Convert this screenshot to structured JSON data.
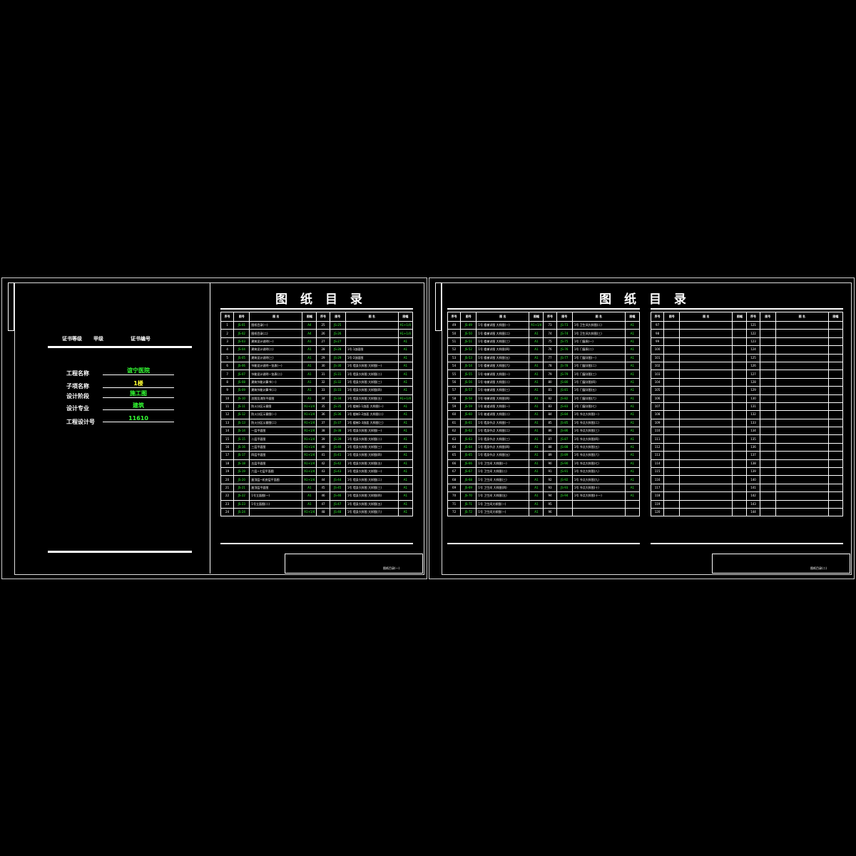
{
  "left_sheet": {
    "title": "图 纸 目 录",
    "cert_grade_label": "证书等级",
    "cert_grade_value": "甲级",
    "cert_number_label": "证书编号",
    "project": [
      {
        "label": "工程名称",
        "value": "谊宁医院"
      },
      {
        "label": "子项名称",
        "value": "1楼"
      },
      {
        "label": "设计阶段",
        "value": "施工图"
      },
      {
        "label": "设计专业",
        "value": "建筑"
      },
      {
        "label": "工程设计号",
        "value": "11610"
      }
    ],
    "headers": [
      "序号",
      "图号",
      "图  名",
      "图幅",
      "序号",
      "图号",
      "图  名",
      "图幅"
    ],
    "rows": [
      [
        "1",
        "JS-01",
        "图纸目录(一)",
        "A4",
        "25",
        "JS-25",
        "",
        "A1+1/4"
      ],
      [
        "2",
        "JS-02",
        "图纸目录(二)",
        "A4",
        "26",
        "JS-26",
        "",
        "A1+1/4"
      ],
      [
        "3",
        "JS-03",
        "建筑设计说明(一)",
        "A1",
        "27",
        "JS-27",
        "",
        "A1"
      ],
      [
        "4",
        "JS-04",
        "建筑设计说明(二)",
        "A1",
        "28",
        "JS-28",
        "1号-1剖面图",
        "A1"
      ],
      [
        "5",
        "JS-05",
        "建筑设计说明(三)",
        "A1",
        "29",
        "JS-29",
        "1号-2剖面图",
        "A1"
      ],
      [
        "6",
        "JS-06",
        "节能设计说明一览表(一)",
        "A1",
        "30",
        "JS-30",
        "1号 墙身大样图 大样图(一)",
        "A1"
      ],
      [
        "7",
        "JS-07",
        "节能设计说明一览表(二)",
        "A1",
        "31",
        "JS-31",
        "1号 墙身大样图 大样图(二)",
        "A1"
      ],
      [
        "8",
        "JS-08",
        "建筑节能计算书(一)",
        "A1",
        "32",
        "JS-32",
        "1号 墙身大样图 大样图(三)",
        "A1"
      ],
      [
        "9",
        "JS-09",
        "建筑节能计算书(二)",
        "A1",
        "33",
        "JS-33",
        "1号 墙身大样图 大样图(四)",
        "A1"
      ],
      [
        "10",
        "JS-10",
        "总图及消防平面图",
        "A1",
        "34",
        "JS-34",
        "1号 墙身大样图 大样图(五)",
        "A1+1/4"
      ],
      [
        "11",
        "JS-11",
        "防火分区示意图",
        "A1+1/4",
        "35",
        "JS-35",
        "1号 楼梯1-1剖面 大样图(一)",
        "A1"
      ],
      [
        "12",
        "JS-12",
        "防火分区示意图(一)",
        "A1+1/4",
        "36",
        "JS-36",
        "1号 楼梯1-2剖面 大样图(二)",
        "A1"
      ],
      [
        "13",
        "JS-13",
        "防火分区示意图(二)",
        "A1+1/4",
        "37",
        "JS-37",
        "1号 楼梯1-3剖面 大样图(三)",
        "A1"
      ],
      [
        "14",
        "JS-14",
        "一层平面图",
        "A1+1/4",
        "38",
        "JS-38",
        "1号 墙身大样图 大样图(一)",
        "A1"
      ],
      [
        "15",
        "JS-15",
        "二层平面图",
        "A1+1/4",
        "39",
        "JS-39",
        "1号 墙身大样图 大样图(二)",
        "A1"
      ],
      [
        "16",
        "JS-16",
        "三层平面图",
        "A1+1/4",
        "40",
        "JS-40",
        "1号 墙身大样图 大样图(三)",
        "A1"
      ],
      [
        "17",
        "JS-17",
        "四层平面图",
        "A1+1/4",
        "41",
        "JS-41",
        "1号 墙身大样图 大样图(四)",
        "A1"
      ],
      [
        "18",
        "JS-18",
        "五层平面图",
        "A1+1/4",
        "42",
        "JS-42",
        "1号 墙身大样图 大样图(五)",
        "A1"
      ],
      [
        "19",
        "JS-19",
        "六层~七层平面图",
        "A1+1/4",
        "43",
        "JS-43",
        "1号 墙身大样图 大样图(一)",
        "A1"
      ],
      [
        "20",
        "JS-20",
        "屋顶层~机房层平面图",
        "A1+1/4",
        "44",
        "JS-44",
        "1号 墙身大样图 大样图(二)",
        "A1"
      ],
      [
        "21",
        "JS-21",
        "屋顶层平面图",
        "A1",
        "45",
        "JS-45",
        "1号 墙身大样图 大样图(三)",
        "A1"
      ],
      [
        "22",
        "JS-22",
        "1号立面图(一)",
        "A1",
        "46",
        "JS-46",
        "1号 墙身大样图 大样图(四)",
        "A1"
      ],
      [
        "23",
        "JS-23",
        "1号立面图(二)",
        "A1",
        "47",
        "JS-47",
        "1号 墙身大样图 大样图(五)",
        "A1"
      ],
      [
        "24",
        "JS-24",
        "",
        "A1+1/4",
        "48",
        "JS-48",
        "1号 墙身大样图 大样图(六)",
        "A1"
      ]
    ],
    "title_block": {
      "name": "图纸目录(一)"
    }
  },
  "right_sheet": {
    "title": "图 纸 目 录",
    "headers": [
      "序号",
      "图号",
      "图  名",
      "图幅",
      "序号",
      "图号",
      "图  名",
      "图幅"
    ],
    "rows": [
      [
        "49",
        "JS-49",
        "1号 楼梯详图 大样图(一)",
        "A1+1/4",
        "73",
        "JS-73",
        "1号 卫生间大样图(二)",
        "A1"
      ],
      [
        "50",
        "JS-50",
        "1号 楼梯详图 大样图(二)",
        "A1",
        "74",
        "JS-74",
        "1号 卫生间大样图(三)",
        "A1"
      ],
      [
        "51",
        "JS-51",
        "1号 楼梯详图 大样图(三)",
        "A1",
        "75",
        "JS-75",
        "1号 门窗表(一)",
        "A1"
      ],
      [
        "52",
        "JS-52",
        "1号 楼梯详图 大样图(四)",
        "A1",
        "76",
        "JS-76",
        "1号 门窗表(二)",
        "A1"
      ],
      [
        "53",
        "JS-53",
        "1号 楼梯详图 大样图(五)",
        "A1",
        "77",
        "JS-77",
        "1号 门窗详图(一)",
        "A1"
      ],
      [
        "54",
        "JS-54",
        "1号 楼梯详图 大样图(六)",
        "A1",
        "78",
        "JS-78",
        "1号 门窗详图(二)",
        "A1"
      ],
      [
        "55",
        "JS-55",
        "1号 电梯详图 大样图(一)",
        "A1",
        "79",
        "JS-79",
        "1号 门窗详图(三)",
        "A1"
      ],
      [
        "56",
        "JS-56",
        "1号 电梯详图 大样图(二)",
        "A1",
        "80",
        "JS-80",
        "1号 门窗详图(四)",
        "A1"
      ],
      [
        "57",
        "JS-57",
        "1号 电梯详图 大样图(三)",
        "A1",
        "81",
        "JS-81",
        "1号 门窗详图(五)",
        "A1"
      ],
      [
        "58",
        "JS-58",
        "1号 电梯详图 大样图(四)",
        "A1",
        "82",
        "JS-82",
        "1号 门窗详图(六)",
        "A1"
      ],
      [
        "59",
        "JS-59",
        "1号 坡道详图 大样图(一)",
        "A1",
        "83",
        "JS-83",
        "1号 门窗详图(七)",
        "A1"
      ],
      [
        "60",
        "JS-60",
        "1号 坡道详图 大样图(二)",
        "A1",
        "84",
        "JS-84",
        "1号 节点大样图(一)",
        "A1"
      ],
      [
        "61",
        "JS-61",
        "1号 墙身节点 大样图(一)",
        "A1",
        "85",
        "JS-85",
        "1号 节点大样图(二)",
        "A1"
      ],
      [
        "62",
        "JS-62",
        "1号 墙身节点 大样图(二)",
        "A1",
        "86",
        "JS-86",
        "1号 节点大样图(三)",
        "A1"
      ],
      [
        "63",
        "JS-63",
        "1号 墙身节点 大样图(三)",
        "A1",
        "87",
        "JS-87",
        "1号 节点大样图(四)",
        "A1"
      ],
      [
        "64",
        "JS-64",
        "1号 墙身节点 大样图(四)",
        "A1",
        "88",
        "JS-88",
        "1号 节点大样图(五)",
        "A1"
      ],
      [
        "65",
        "JS-65",
        "1号 墙身节点 大样图(五)",
        "A1",
        "89",
        "JS-89",
        "1号 节点大样图(六)",
        "A1"
      ],
      [
        "66",
        "JS-66",
        "1号 卫生间 大样图(一)",
        "A1",
        "90",
        "JS-90",
        "1号 节点大样图(七)",
        "A1"
      ],
      [
        "67",
        "JS-67",
        "1号 卫生间 大样图(二)",
        "A1",
        "91",
        "JS-91",
        "1号 节点大样图(八)",
        "A1"
      ],
      [
        "68",
        "JS-68",
        "1号 卫生间 大样图(三)",
        "A1",
        "92",
        "JS-92",
        "1号 节点大样图(九)",
        "A1"
      ],
      [
        "69",
        "JS-69",
        "1号 卫生间 大样图(四)",
        "A1",
        "93",
        "JS-93",
        "1号 节点大样图(十)",
        "A1"
      ],
      [
        "70",
        "JS-70",
        "1号 卫生间 大样图(五)",
        "A1",
        "94",
        "JS-94",
        "1号 节点大样图(十一)",
        "A1"
      ],
      [
        "71",
        "JS-71",
        "1号 卫生间大样图(一)",
        "A1",
        "95",
        "",
        "",
        ""
      ],
      [
        "72",
        "JS-72",
        "1号 卫生间大样图(一)",
        "A1",
        "96",
        "",
        "",
        ""
      ]
    ],
    "extra_headers": [
      "序号",
      "图号",
      "图  名",
      "图幅",
      "序号",
      "图号",
      "图  名",
      "图幅"
    ],
    "extra_rows": [
      [
        "97",
        "",
        "",
        "",
        "121",
        "",
        "",
        ""
      ],
      [
        "98",
        "",
        "",
        "",
        "122",
        "",
        "",
        ""
      ],
      [
        "99",
        "",
        "",
        "",
        "123",
        "",
        "",
        ""
      ],
      [
        "100",
        "",
        "",
        "",
        "124",
        "",
        "",
        ""
      ],
      [
        "101",
        "",
        "",
        "",
        "125",
        "",
        "",
        ""
      ],
      [
        "102",
        "",
        "",
        "",
        "126",
        "",
        "",
        ""
      ],
      [
        "103",
        "",
        "",
        "",
        "127",
        "",
        "",
        ""
      ],
      [
        "104",
        "",
        "",
        "",
        "128",
        "",
        "",
        ""
      ],
      [
        "105",
        "",
        "",
        "",
        "129",
        "",
        "",
        ""
      ],
      [
        "106",
        "",
        "",
        "",
        "130",
        "",
        "",
        ""
      ],
      [
        "107",
        "",
        "",
        "",
        "131",
        "",
        "",
        ""
      ],
      [
        "108",
        "",
        "",
        "",
        "132",
        "",
        "",
        ""
      ],
      [
        "109",
        "",
        "",
        "",
        "133",
        "",
        "",
        ""
      ],
      [
        "110",
        "",
        "",
        "",
        "134",
        "",
        "",
        ""
      ],
      [
        "111",
        "",
        "",
        "",
        "135",
        "",
        "",
        ""
      ],
      [
        "112",
        "",
        "",
        "",
        "136",
        "",
        "",
        ""
      ],
      [
        "113",
        "",
        "",
        "",
        "137",
        "",
        "",
        ""
      ],
      [
        "114",
        "",
        "",
        "",
        "138",
        "",
        "",
        ""
      ],
      [
        "115",
        "",
        "",
        "",
        "139",
        "",
        "",
        ""
      ],
      [
        "116",
        "",
        "",
        "",
        "140",
        "",
        "",
        ""
      ],
      [
        "117",
        "",
        "",
        "",
        "141",
        "",
        "",
        ""
      ],
      [
        "118",
        "",
        "",
        "",
        "142",
        "",
        "",
        ""
      ],
      [
        "119",
        "",
        "",
        "",
        "143",
        "",
        "",
        ""
      ],
      [
        "120",
        "",
        "",
        "",
        "144",
        "",
        "",
        ""
      ]
    ],
    "title_block": {
      "name": "图纸目录(二)"
    }
  },
  "colors": {
    "text": "#ffffff",
    "green": "#33ff33",
    "yellow": "#ffff33"
  }
}
